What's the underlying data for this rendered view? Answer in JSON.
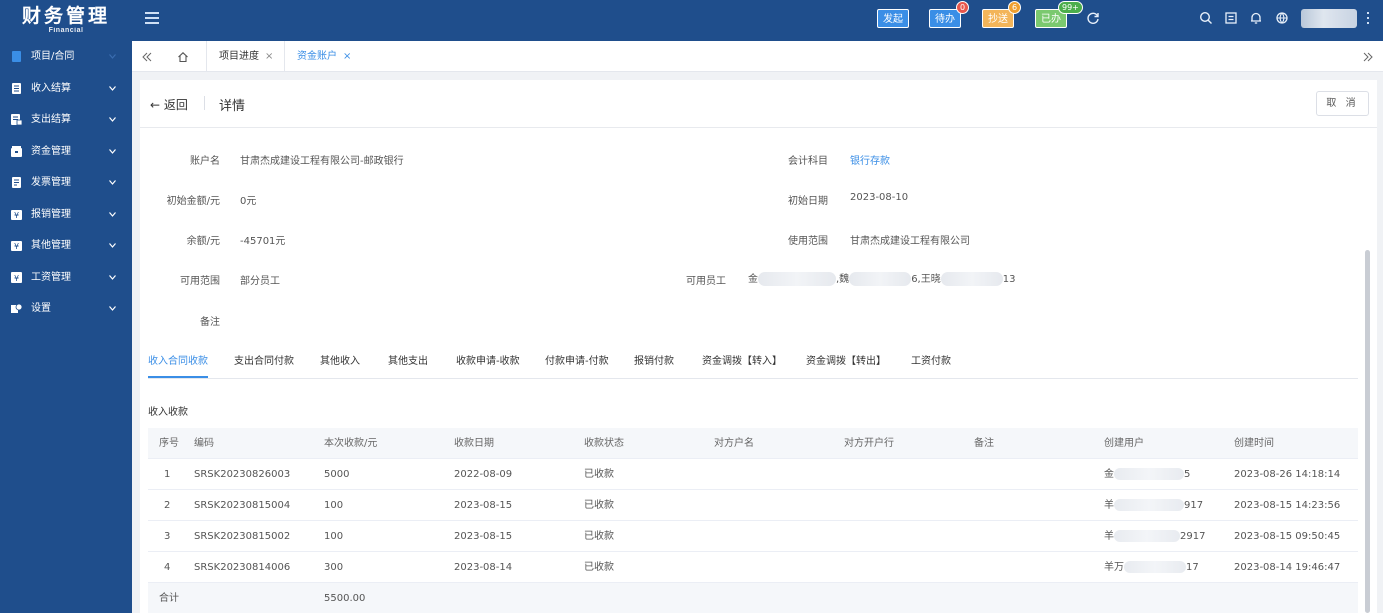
{
  "app": {
    "title": "财务管理",
    "subtitle": "Financial",
    "toolbar": {
      "initiate": "发起",
      "todo": "待办",
      "todo_count": "0",
      "cc": "抄送",
      "cc_count": "6",
      "done": "已办",
      "done_count": "99+"
    }
  },
  "sidebar": {
    "items": [
      {
        "label": "项目/合同"
      },
      {
        "label": "收入结算"
      },
      {
        "label": "支出结算"
      },
      {
        "label": "资金管理"
      },
      {
        "label": "发票管理"
      },
      {
        "label": "报销管理"
      },
      {
        "label": "其他管理"
      },
      {
        "label": "工资管理"
      },
      {
        "label": "设置"
      }
    ]
  },
  "tabs": {
    "items": [
      {
        "label": "项目进度",
        "close": "×"
      },
      {
        "label": "资金账户",
        "close": "×"
      }
    ]
  },
  "header": {
    "back": "← 返回",
    "title": "详情",
    "cancel": "取 消"
  },
  "details": {
    "account_name_label": "账户名",
    "account_name": "甘肃杰成建设工程有限公司-邮政银行",
    "subject_label": "会计科目",
    "subject": "银行存款",
    "initial_amount_label": "初始金额/元",
    "initial_amount": "0元",
    "initial_date_label": "初始日期",
    "initial_date": "2023-08-10",
    "balance_label": "余额/元",
    "balance": "-45701元",
    "usage_scope_label": "使用范围",
    "usage_scope": "甘肃杰成建设工程有限公司",
    "available_scope_label": "可用范围",
    "available_scope": "部分员工",
    "available_staff_label": "可用员工",
    "staff_part1": "金",
    "staff_part2": ",魏",
    "staff_part3": "6,王晓",
    "staff_part4": "13",
    "remark_label": "备注"
  },
  "sub_tabs": [
    {
      "label": "收入合同收款"
    },
    {
      "label": "支出合同付款"
    },
    {
      "label": "其他收入"
    },
    {
      "label": "其他支出"
    },
    {
      "label": "收款申请-收款"
    },
    {
      "label": "付款申请-付款"
    },
    {
      "label": "报销付款"
    },
    {
      "label": "资金调拨【转入】"
    },
    {
      "label": "资金调拨【转出】"
    },
    {
      "label": "工资付款"
    }
  ],
  "section": {
    "label": "收入收款"
  },
  "table": {
    "columns": [
      "序号",
      "编码",
      "本次收款/元",
      "收款日期",
      "收款状态",
      "对方户名",
      "对方开户行",
      "备注",
      "创建用户",
      "创建时间"
    ],
    "rows": [
      {
        "no": "1",
        "code": "SRSK20230826003",
        "amount": "5000",
        "date": "2022-08-09",
        "status": "已收款",
        "user_a": "金",
        "user_b": "5",
        "created": "2023-08-26 14:18:14"
      },
      {
        "no": "2",
        "code": "SRSK20230815004",
        "amount": "100",
        "date": "2023-08-15",
        "status": "已收款",
        "user_a": "羊",
        "user_b": "917",
        "created": "2023-08-15 14:23:56"
      },
      {
        "no": "3",
        "code": "SRSK20230815002",
        "amount": "100",
        "date": "2023-08-15",
        "status": "已收款",
        "user_a": "羊",
        "user_b": "2917",
        "created": "2023-08-15 09:50:45"
      },
      {
        "no": "4",
        "code": "SRSK20230814006",
        "amount": "300",
        "date": "2023-08-14",
        "status": "已收款",
        "user_a": "羊万",
        "user_b": "17",
        "created": "2023-08-14 19:46:47"
      }
    ],
    "total_label": "合计",
    "total_amount": "5500.00"
  },
  "colors": {
    "brand": "#1f4e8c",
    "accent": "#3a8ee6"
  }
}
